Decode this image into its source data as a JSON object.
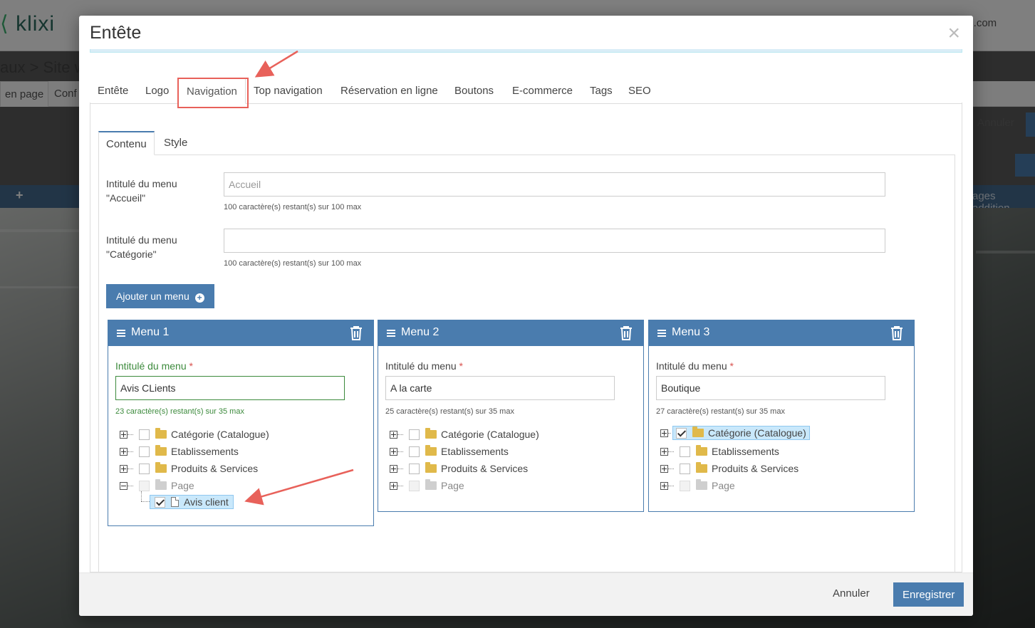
{
  "background": {
    "logo": "klixi",
    "email_fragment": "il.com",
    "breadcrumb": "aux > Site we",
    "subtabs": [
      "en page",
      "Conf"
    ],
    "cancel_label": "Annuler",
    "toolbar_text": "ages addition"
  },
  "modal": {
    "title": "Entête",
    "close_icon": "close-icon",
    "tabs": [
      {
        "label": "Entête"
      },
      {
        "label": "Logo"
      },
      {
        "label": "Navigation",
        "active": true
      },
      {
        "label": "Top navigation"
      },
      {
        "label": "Réservation en ligne"
      },
      {
        "label": "Boutons"
      },
      {
        "label": "E-commerce"
      },
      {
        "label": "Tags"
      },
      {
        "label": "SEO"
      }
    ],
    "subtabs": [
      {
        "label": "Contenu",
        "active": true
      },
      {
        "label": "Style"
      }
    ],
    "fields": {
      "accueil": {
        "label": "Intitulé du menu \"Accueil\"",
        "value": "",
        "placeholder": "Accueil",
        "help": "100 caractère(s) restant(s) sur 100 max"
      },
      "categorie": {
        "label": "Intitulé du menu \"Catégorie\"",
        "value": "",
        "placeholder": "",
        "help": "100 caractère(s) restant(s) sur 100 max"
      }
    },
    "add_menu_label": "Ajouter un menu",
    "menus": [
      {
        "title": "Menu 1",
        "field_label": "Intitulé du menu",
        "required_mark": "*",
        "value": "Avis CLients",
        "help": "23 caractère(s) restant(s) sur 35 max",
        "tree": [
          {
            "label": "Catégorie (Catalogue)",
            "checked": false
          },
          {
            "label": "Etablissements",
            "checked": false
          },
          {
            "label": "Produits & Services",
            "checked": false
          },
          {
            "label": "Page",
            "checked": false,
            "expanded": true,
            "disabled": true
          },
          {
            "label": "Avis client",
            "checked": true,
            "child": true
          }
        ]
      },
      {
        "title": "Menu 2",
        "field_label": "Intitulé du menu",
        "required_mark": "*",
        "value": "A la carte",
        "help": "25 caractère(s) restant(s) sur 35 max",
        "tree": [
          {
            "label": "Catégorie (Catalogue)",
            "checked": false
          },
          {
            "label": "Etablissements",
            "checked": false
          },
          {
            "label": "Produits & Services",
            "checked": false
          },
          {
            "label": "Page",
            "checked": false,
            "disabled": true
          }
        ]
      },
      {
        "title": "Menu 3",
        "field_label": "Intitulé du menu",
        "required_mark": "*",
        "value": "Boutique",
        "help": "27 caractère(s) restant(s) sur 35 max",
        "tree": [
          {
            "label": "Catégorie (Catalogue)",
            "checked": true
          },
          {
            "label": "Etablissements",
            "checked": false
          },
          {
            "label": "Produits & Services",
            "checked": false
          },
          {
            "label": "Page",
            "checked": false,
            "disabled": true
          }
        ]
      }
    ],
    "footer": {
      "cancel_label": "Annuler",
      "save_label": "Enregistrer"
    }
  },
  "colors": {
    "primary": "#4a7cae",
    "success": "#3c8a3c",
    "annotation": "#e8615a",
    "folder": "#e0b94a"
  }
}
